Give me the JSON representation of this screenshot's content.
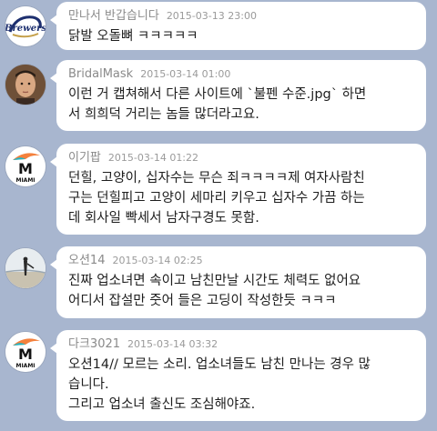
{
  "messages": [
    {
      "author": "만나서 반갑습니다",
      "time": "2015-03-13 23:00",
      "avatar": "brewers-logo-icon",
      "lines": [
        "닭발 오돌뼈 ㅋㅋㅋㅋㅋ"
      ]
    },
    {
      "author": "BridalMask",
      "time": "2015-03-14 01:00",
      "avatar": "profile-photo-icon",
      "lines": [
        "이런 거 캡쳐해서 다른 사이트에 `불펜 수준.jpg` 하면",
        "서 희희덕 거리는 놈들 많더라고요."
      ]
    },
    {
      "author": "이기팝",
      "time": "2015-03-14 01:22",
      "avatar": "marlins-logo-icon",
      "lines": [
        "던힐, 고양이, 십자수는 무슨 죄ㅋㅋㅋㅋ제 여자사람친",
        "구는 던힐피고 고양이 세마리 키우고 십자수 가끔 하는",
        "데 회사일 빡세서 남자구경도 못함."
      ]
    },
    {
      "author": "오션14",
      "time": "2015-03-14 02:25",
      "avatar": "beach-photo-icon",
      "lines": [
        "진짜 업소녀면 속이고 남친만날 시간도 체력도 없어요",
        "어디서 잡설만 줏어 들은 고딩이 작성한듯 ㅋㅋㅋ"
      ]
    },
    {
      "author": "다크3021",
      "time": "2015-03-14 03:32",
      "avatar": "marlins-logo-icon",
      "lines": [
        "오션14// 모르는 소리. 업소녀들도 남친 만나는 경우 많",
        "습니다.",
        "그리고 업소녀 출신도 조심해야죠."
      ]
    }
  ],
  "marlins_logo_text": "MIAMI"
}
